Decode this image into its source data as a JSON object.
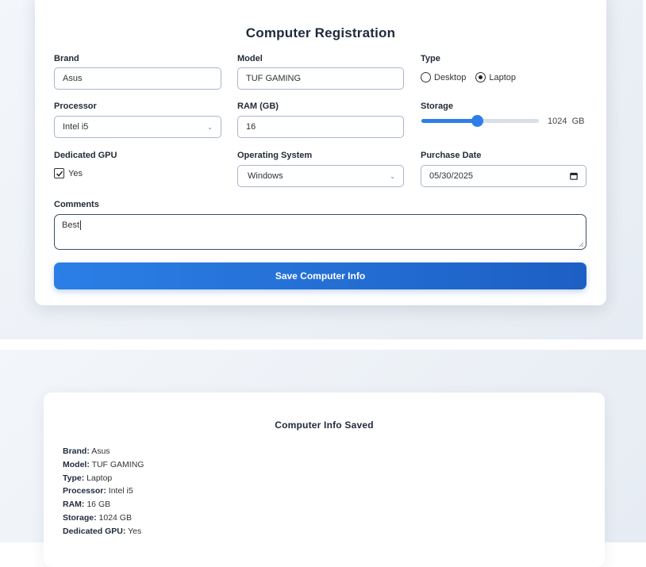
{
  "form": {
    "title": "Computer Registration",
    "brand": {
      "label": "Brand",
      "value": "Asus"
    },
    "model": {
      "label": "Model",
      "value": "TUF GAMING"
    },
    "type": {
      "label": "Type",
      "options": [
        "Desktop",
        "Laptop"
      ],
      "selected": "Laptop"
    },
    "processor": {
      "label": "Processor",
      "value": "Intel i5"
    },
    "ram": {
      "label": "RAM (GB)",
      "value": "16"
    },
    "storage": {
      "label": "Storage",
      "value": "1024",
      "unit": "GB",
      "fill_fraction": 0.47
    },
    "gpu": {
      "label": "Dedicated GPU",
      "checkbox_label": "Yes",
      "checked": true
    },
    "os": {
      "label": "Operating System",
      "value": "Windows"
    },
    "purchase_date": {
      "label": "Purchase Date",
      "value": "05/30/2025"
    },
    "comments": {
      "label": "Comments",
      "value": "Best"
    },
    "save_label": "Save Computer Info"
  },
  "saved": {
    "title": "Computer Info Saved",
    "rows": [
      {
        "key": "Brand:",
        "value": "Asus"
      },
      {
        "key": "Model:",
        "value": "TUF GAMING"
      },
      {
        "key": "Type:",
        "value": "Laptop"
      },
      {
        "key": "Processor:",
        "value": "Intel i5"
      },
      {
        "key": "RAM:",
        "value": "16 GB"
      },
      {
        "key": "Storage:",
        "value": "1024 GB"
      },
      {
        "key": "Dedicated GPU:",
        "value": "Yes"
      }
    ]
  },
  "colors": {
    "accent": "#2d7ee8",
    "button_end": "#1d5fc4",
    "background": "#e6ecf3"
  },
  "icons": [
    "chevron-down-icon",
    "calendar-icon",
    "checkmark-icon",
    "resize-handle-icon"
  ]
}
